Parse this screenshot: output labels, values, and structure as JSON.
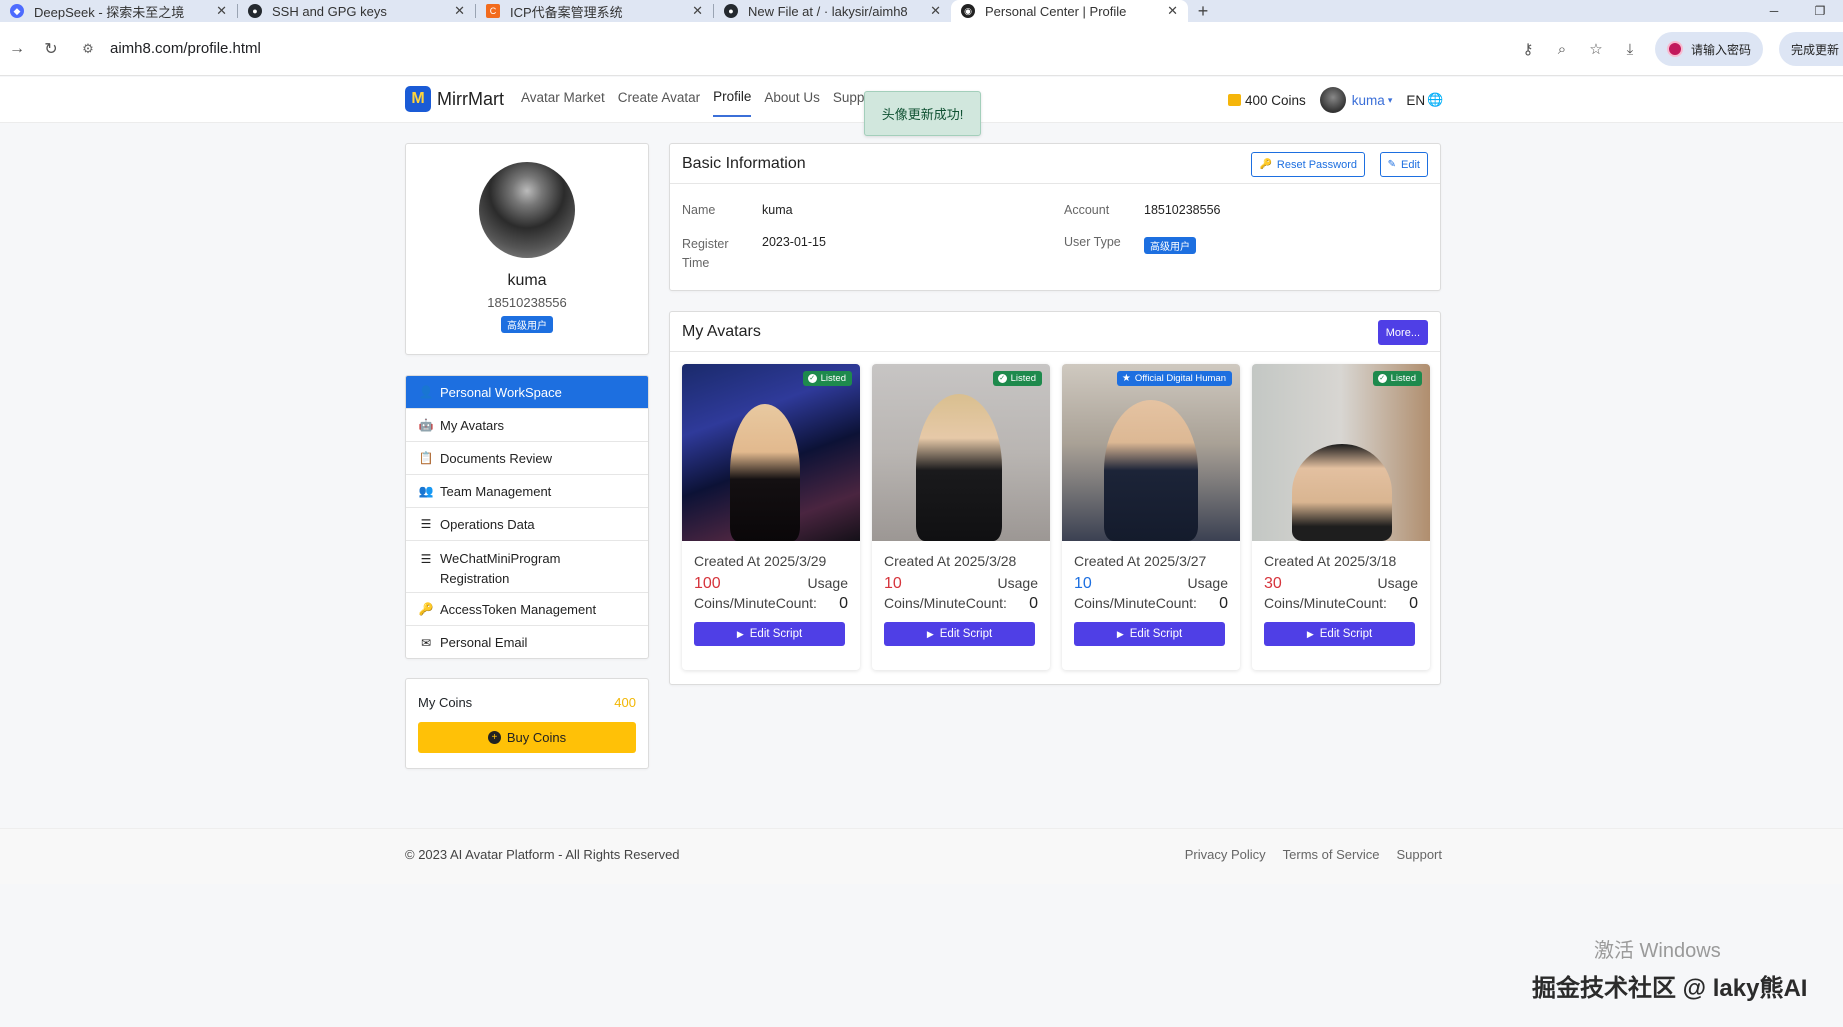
{
  "browser": {
    "tabs": [
      {
        "title": "DeepSeek - 探索未至之境",
        "favicon_color": "#4d6bfe",
        "active": false
      },
      {
        "title": "SSH and GPG keys",
        "favicon_color": "#24292f",
        "active": false
      },
      {
        "title": "ICP代备案管理系统",
        "favicon_color": "#f26b1d",
        "active": false
      },
      {
        "title": "New File at / · lakysir/aimh8",
        "favicon_color": "#24292f",
        "active": false
      },
      {
        "title": "Personal Center | Profile",
        "favicon_color": "#222222",
        "active": true
      }
    ],
    "url": "aimh8.com/profile.html",
    "password_pill": "请输入密码",
    "update_pill": "完成更新"
  },
  "site": {
    "brand": "MirrMart",
    "menu": [
      "Avatar Market",
      "Create Avatar",
      "Profile",
      "About Us",
      "Supp"
    ],
    "active_menu": "Profile",
    "toast": "头像更新成功!",
    "coins_label": "400 Coins",
    "user": "kuma",
    "lang": "EN"
  },
  "profile": {
    "name": "kuma",
    "account": "18510238556",
    "badge": "高级用户"
  },
  "sidemenu": [
    {
      "label": "Personal WorkSpace",
      "icon": "user-icon",
      "glyph": "👤",
      "active": true
    },
    {
      "label": "My Avatars",
      "icon": "robot-icon",
      "glyph": "🤖",
      "active": false
    },
    {
      "label": "Documents Review",
      "icon": "clipboard-icon",
      "glyph": "📋",
      "active": false
    },
    {
      "label": "Team Management",
      "icon": "users-icon",
      "glyph": "👥",
      "active": false
    },
    {
      "label": "Operations Data",
      "icon": "sliders-icon",
      "glyph": "☰",
      "active": false
    },
    {
      "label": "WeChatMiniProgram Registration",
      "icon": "sliders-icon",
      "glyph": "☰",
      "active": false
    },
    {
      "label": "AccessToken Management",
      "icon": "key-icon",
      "glyph": "🔑",
      "active": false
    },
    {
      "label": "Personal Email",
      "icon": "envelope-icon",
      "glyph": "✉",
      "active": false
    }
  ],
  "coins": {
    "label": "My Coins",
    "value": "400",
    "buy_label": "Buy Coins"
  },
  "basic": {
    "title": "Basic Information",
    "reset_label": "Reset Password",
    "edit_label": "Edit",
    "name_label": "Name",
    "name_value": "kuma",
    "account_label": "Account",
    "account_value": "18510238556",
    "register_label_1": "Register",
    "register_label_2": "Time",
    "register_value": "2023-01-15",
    "usertype_label": "User Type",
    "usertype_value": "高级用户"
  },
  "avatars": {
    "title": "My Avatars",
    "more_label": "More...",
    "price_unit": "Coins/Minute",
    "usage_label": "Usage",
    "count_label": "Count:",
    "edit_label": "Edit Script",
    "items": [
      {
        "status": "Listed",
        "official": false,
        "created": "Created At 2025/3/29",
        "price": "100",
        "count": "0",
        "price_color": "#d6343c"
      },
      {
        "status": "Listed",
        "official": false,
        "created": "Created At 2025/3/28",
        "price": "10",
        "count": "0",
        "price_color": "#d6343c"
      },
      {
        "status": "Official Digital Human",
        "official": true,
        "created": "Created At 2025/3/27",
        "price": "10",
        "count": "0",
        "price_color": "#1d6fe0"
      },
      {
        "status": "Listed",
        "official": false,
        "created": "Created At 2025/3/18",
        "price": "30",
        "count": "0",
        "price_color": "#d6343c"
      }
    ]
  },
  "footer": {
    "copyright": "© 2023 AI Avatar Platform - All Rights Reserved",
    "links": [
      "Privacy Policy",
      "Terms of Service",
      "Support"
    ]
  },
  "watermarks": {
    "windows": "激活 Windows",
    "community": "掘金技术社区 @ laky熊AI"
  },
  "colors": {
    "primary": "#1d6fe0",
    "accent_button": "#4f3fe6",
    "listed_badge": "#1e8a4d",
    "coins_gold": "#ffc107"
  }
}
